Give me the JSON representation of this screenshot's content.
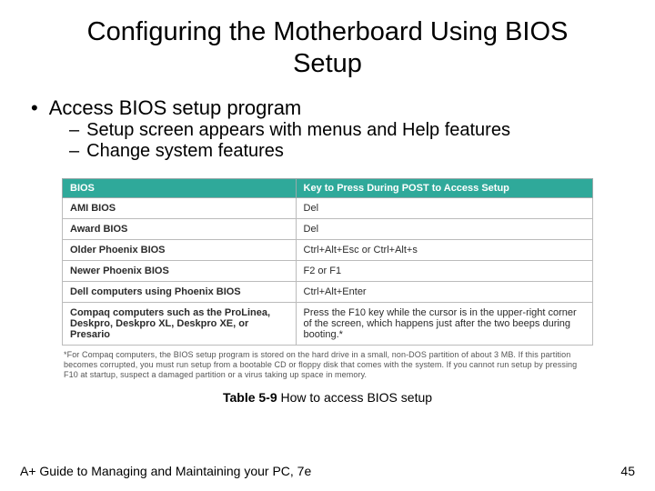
{
  "title": "Configuring the Motherboard Using BIOS Setup",
  "bullet1": "Access BIOS setup program",
  "sub1": "Setup screen appears with menus and Help features",
  "sub2": "Change system features",
  "table": {
    "h1": "BIOS",
    "h2": "Key to Press During POST to Access Setup",
    "rows": [
      {
        "c1": "AMI BIOS",
        "c2": "Del"
      },
      {
        "c1": "Award BIOS",
        "c2": "Del"
      },
      {
        "c1": "Older Phoenix BIOS",
        "c2": "Ctrl+Alt+Esc or Ctrl+Alt+s"
      },
      {
        "c1": "Newer Phoenix BIOS",
        "c2": "F2 or F1"
      },
      {
        "c1": "Dell computers using Phoenix BIOS",
        "c2": "Ctrl+Alt+Enter"
      },
      {
        "c1": "Compaq computers such as the ProLinea, Deskpro, Deskpro XL, Deskpro XE, or Presario",
        "c2": "Press the F10 key while the cursor is in the upper-right corner of the screen, which happens just after the two beeps during booting.*"
      }
    ]
  },
  "footnote": "*For Compaq computers, the BIOS setup program is stored on the hard drive in a small, non-DOS partition of about 3 MB. If this partition becomes corrupted, you must run setup from a bootable CD or floppy disk that comes with the system. If you cannot run setup by pressing F10 at startup, suspect a damaged partition or a virus taking up space in memory.",
  "caption_label": "Table 5-9",
  "caption_text": " How to access BIOS setup",
  "footer_left": "A+ Guide to Managing and Maintaining your PC, 7e",
  "footer_right": "45"
}
